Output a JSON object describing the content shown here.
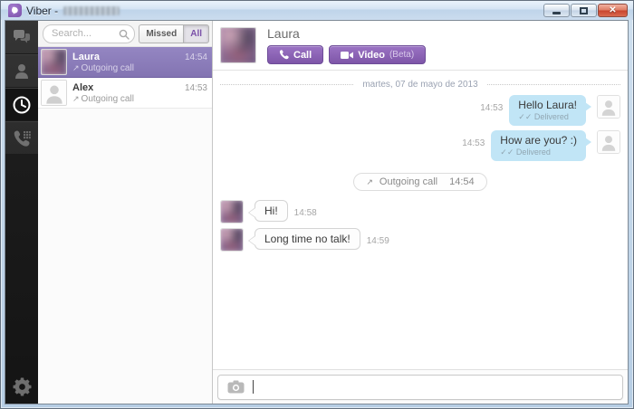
{
  "window": {
    "title": "Viber -",
    "controls": {
      "minimize": "minimize",
      "maximize": "maximize",
      "close": "close"
    }
  },
  "sidebar": {
    "items": [
      {
        "name": "chats",
        "active": false
      },
      {
        "name": "contacts",
        "active": false
      },
      {
        "name": "recents",
        "active": true
      },
      {
        "name": "keypad",
        "active": false
      }
    ],
    "settings": "settings"
  },
  "contacts_panel": {
    "search_placeholder": "Search...",
    "filters": [
      {
        "label": "Missed",
        "active": false
      },
      {
        "label": "All",
        "active": true
      }
    ],
    "contacts": [
      {
        "name": "Laura",
        "time": "14:54",
        "status": "Outgoing call",
        "selected": true
      },
      {
        "name": "Alex",
        "time": "14:53",
        "status": "Outgoing call",
        "selected": false
      }
    ]
  },
  "chat": {
    "contact_name": "Laura",
    "call_button": "Call",
    "video_button": "Video",
    "video_beta": "(Beta)",
    "date_divider": "martes, 07 de mayo de 2013",
    "messages": [
      {
        "direction": "out",
        "text": "Hello Laura!",
        "time": "14:53",
        "status": "Delivered"
      },
      {
        "direction": "out",
        "text": "How are you? :)",
        "time": "14:53",
        "status": "Delivered"
      },
      {
        "type": "call-event",
        "text": "Outgoing call",
        "time": "14:54"
      },
      {
        "direction": "in",
        "text": "Hi!",
        "time": "14:58"
      },
      {
        "direction": "in",
        "text": "Long time no talk!",
        "time": "14:59"
      }
    ],
    "composer": {
      "value": ""
    }
  },
  "icons": {
    "outgoing_call_arrow": "↗",
    "delivered_checks": "✓✓",
    "close_glyph": "✕"
  },
  "colors": {
    "accent_purple": "#7e56a8",
    "selected_contact": "#8374b2",
    "bubble_blue": "#c1e5f6",
    "sidebar_bg": "#232323",
    "titlebar_blue": "#cbdcee"
  }
}
